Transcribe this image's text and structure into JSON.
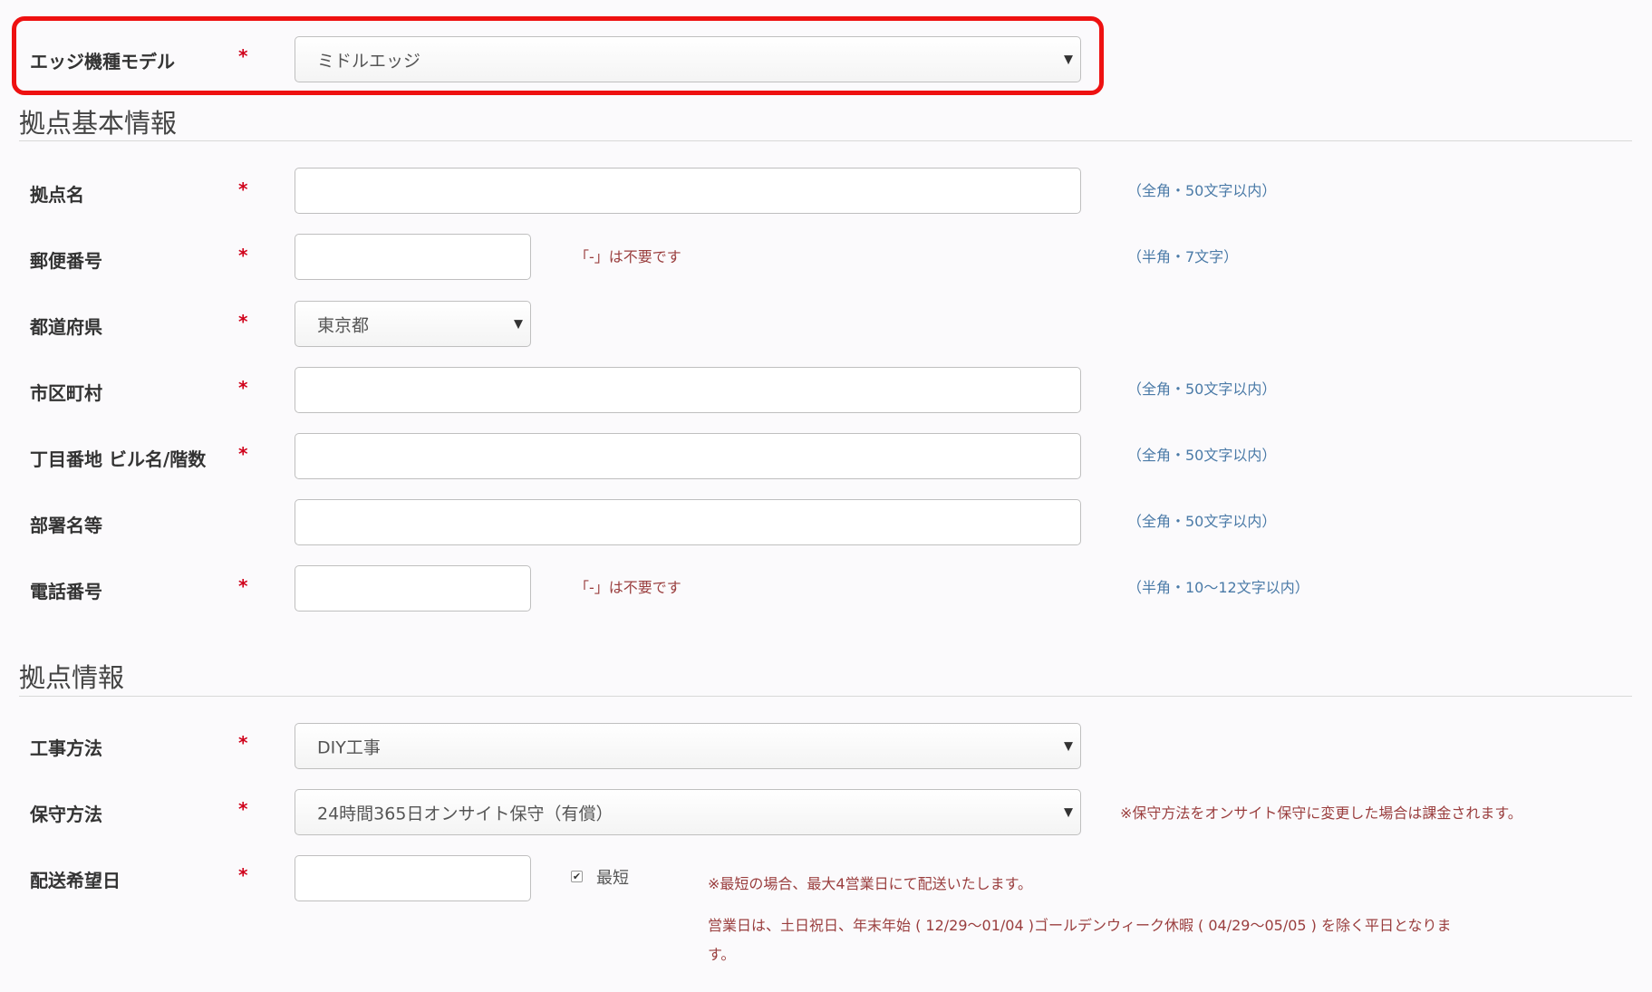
{
  "edge_model": {
    "label": "エッジ機種モデル",
    "required_mark": "*",
    "selected": "ミドルエッジ"
  },
  "sections": {
    "basic_info_title": "拠点基本情報",
    "site_info_title": "拠点情報"
  },
  "fields": {
    "site_name": {
      "label": "拠点名",
      "required_mark": "*",
      "value": "",
      "hint": "（全角・50文字以内）"
    },
    "postal_code": {
      "label": "郵便番号",
      "required_mark": "*",
      "value": "",
      "note": "「-」は不要です",
      "hint": "（半角・7文字）"
    },
    "prefecture": {
      "label": "都道府県",
      "required_mark": "*",
      "selected": "東京都"
    },
    "city": {
      "label": "市区町村",
      "required_mark": "*",
      "value": "",
      "hint": "（全角・50文字以内）"
    },
    "address": {
      "label": "丁目番地 ビル名/階数",
      "required_mark": "*",
      "value": "",
      "hint": "（全角・50文字以内）"
    },
    "department": {
      "label": "部署名等",
      "value": "",
      "hint": "（全角・50文字以内）"
    },
    "phone": {
      "label": "電話番号",
      "required_mark": "*",
      "value": "",
      "note": "「-」は不要です",
      "hint": "（半角・10〜12文字以内）"
    },
    "construction_method": {
      "label": "工事方法",
      "required_mark": "*",
      "selected": "DIY工事"
    },
    "maintenance_method": {
      "label": "保守方法",
      "required_mark": "*",
      "selected": "24時間365日オンサイト保守（有償）",
      "note": "※保守方法をオンサイト保守に変更した場合は課金されます。"
    },
    "delivery_date": {
      "label": "配送希望日",
      "required_mark": "*",
      "value": "",
      "checkbox_label": "最短",
      "checkbox_checked": true,
      "note1": "※最短の場合、最大4営業日にて配送いたします。",
      "note2_line1": "営業日は、土日祝日、年末年始 ( 12/29〜01/04 )ゴールデンウィーク休暇 ( 04/29〜05/05 ) を除く平日となりま",
      "note2_line2": "す。"
    }
  },
  "icons": {
    "dropdown": "triangle-down-icon",
    "checkbox": "checkmark-icon"
  },
  "colors": {
    "required": "#d0021b",
    "hint": "#4a7aa7",
    "warning": "#9a3e3e",
    "highlight": "#ee1111"
  }
}
